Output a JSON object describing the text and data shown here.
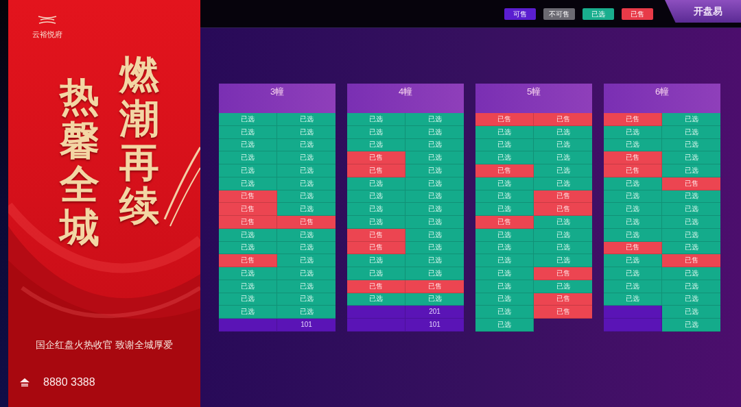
{
  "poster": {
    "brand": "云裕悦府",
    "headline_columns": [
      "燃潮再续",
      "热馨全城"
    ],
    "tagline": "国企红盘火热收官 致谢全城厚爱",
    "phone": "8880 3388"
  },
  "top_bar": {
    "legend": [
      {
        "label": "可售",
        "color": "#5a1ed0"
      },
      {
        "label": "不可售",
        "color": "#6b6a72"
      },
      {
        "label": "已选",
        "color": "#19ae8e"
      },
      {
        "label": "已售",
        "color": "#e83a48"
      }
    ],
    "tab": {
      "label": "开盘易"
    }
  },
  "buildings": [
    {
      "name": "3幢",
      "rows": [
        [
          {
            "kind": "selected",
            "text": "已选"
          },
          {
            "kind": "selected",
            "text": "已选"
          }
        ],
        [
          {
            "kind": "selected",
            "text": "已选"
          },
          {
            "kind": "selected",
            "text": "已选"
          }
        ],
        [
          {
            "kind": "selected",
            "text": "已选"
          },
          {
            "kind": "selected",
            "text": "已选"
          }
        ],
        [
          {
            "kind": "selected",
            "text": "已选"
          },
          {
            "kind": "selected",
            "text": "已选"
          }
        ],
        [
          {
            "kind": "selected",
            "text": "已选"
          },
          {
            "kind": "selected",
            "text": "已选"
          }
        ],
        [
          {
            "kind": "selected",
            "text": "已选"
          },
          {
            "kind": "selected",
            "text": "已选"
          }
        ],
        [
          {
            "kind": "sold",
            "text": "已售"
          },
          {
            "kind": "selected",
            "text": "已选"
          }
        ],
        [
          {
            "kind": "sold",
            "text": "已售"
          },
          {
            "kind": "selected",
            "text": "已选"
          }
        ],
        [
          {
            "kind": "sold",
            "text": "已售"
          },
          {
            "kind": "sold",
            "text": "已售"
          }
        ],
        [
          {
            "kind": "selected",
            "text": "已选"
          },
          {
            "kind": "selected",
            "text": "已选"
          }
        ],
        [
          {
            "kind": "selected",
            "text": "已选"
          },
          {
            "kind": "selected",
            "text": "已选"
          }
        ],
        [
          {
            "kind": "sold",
            "text": "已售"
          },
          {
            "kind": "selected",
            "text": "已选"
          }
        ],
        [
          {
            "kind": "selected",
            "text": "已选"
          },
          {
            "kind": "selected",
            "text": "已选"
          }
        ],
        [
          {
            "kind": "selected",
            "text": "已选"
          },
          {
            "kind": "selected",
            "text": "已选"
          }
        ],
        [
          {
            "kind": "selected",
            "text": "已选"
          },
          {
            "kind": "selected",
            "text": "已选"
          }
        ],
        [
          {
            "kind": "selected",
            "text": "已选"
          },
          {
            "kind": "selected",
            "text": "已选"
          }
        ],
        [
          {
            "kind": "forsale"
          },
          {
            "kind": "forsale",
            "text": "101"
          }
        ]
      ]
    },
    {
      "name": "4幢",
      "rows": [
        [
          {
            "kind": "selected",
            "text": "已选"
          },
          {
            "kind": "selected",
            "text": "已选"
          }
        ],
        [
          {
            "kind": "selected",
            "text": "已选"
          },
          {
            "kind": "selected",
            "text": "已选"
          }
        ],
        [
          {
            "kind": "selected",
            "text": "已选"
          },
          {
            "kind": "selected",
            "text": "已选"
          }
        ],
        [
          {
            "kind": "sold",
            "text": "已售"
          },
          {
            "kind": "selected",
            "text": "已选"
          }
        ],
        [
          {
            "kind": "sold",
            "text": "已售"
          },
          {
            "kind": "selected",
            "text": "已选"
          }
        ],
        [
          {
            "kind": "selected",
            "text": "已选"
          },
          {
            "kind": "selected",
            "text": "已选"
          }
        ],
        [
          {
            "kind": "selected",
            "text": "已选"
          },
          {
            "kind": "selected",
            "text": "已选"
          }
        ],
        [
          {
            "kind": "selected",
            "text": "已选"
          },
          {
            "kind": "selected",
            "text": "已选"
          }
        ],
        [
          {
            "kind": "selected",
            "text": "已选"
          },
          {
            "kind": "selected",
            "text": "已选"
          }
        ],
        [
          {
            "kind": "sold",
            "text": "已售"
          },
          {
            "kind": "selected",
            "text": "已选"
          }
        ],
        [
          {
            "kind": "sold",
            "text": "已售"
          },
          {
            "kind": "selected",
            "text": "已选"
          }
        ],
        [
          {
            "kind": "selected",
            "text": "已选"
          },
          {
            "kind": "selected",
            "text": "已选"
          }
        ],
        [
          {
            "kind": "selected",
            "text": "已选"
          },
          {
            "kind": "selected",
            "text": "已选"
          }
        ],
        [
          {
            "kind": "sold",
            "text": "已售"
          },
          {
            "kind": "sold",
            "text": "已售"
          }
        ],
        [
          {
            "kind": "selected",
            "text": "已选"
          },
          {
            "kind": "selected",
            "text": "已选"
          }
        ],
        [
          {
            "kind": "forsale"
          },
          {
            "kind": "forsale",
            "text": "201"
          }
        ],
        [
          {
            "kind": "forsale"
          },
          {
            "kind": "forsale",
            "text": "101"
          }
        ]
      ]
    },
    {
      "name": "5幢",
      "rows": [
        [
          {
            "kind": "sold",
            "text": "已售"
          },
          {
            "kind": "sold",
            "text": "已售"
          }
        ],
        [
          {
            "kind": "selected",
            "text": "已选"
          },
          {
            "kind": "selected",
            "text": "已选"
          }
        ],
        [
          {
            "kind": "selected",
            "text": "已选"
          },
          {
            "kind": "selected",
            "text": "已选"
          }
        ],
        [
          {
            "kind": "selected",
            "text": "已选"
          },
          {
            "kind": "selected",
            "text": "已选"
          }
        ],
        [
          {
            "kind": "sold",
            "text": "已售"
          },
          {
            "kind": "selected",
            "text": "已选"
          }
        ],
        [
          {
            "kind": "selected",
            "text": "已选"
          },
          {
            "kind": "selected",
            "text": "已选"
          }
        ],
        [
          {
            "kind": "selected",
            "text": "已选"
          },
          {
            "kind": "sold",
            "text": "已售"
          }
        ],
        [
          {
            "kind": "selected",
            "text": "已选"
          },
          {
            "kind": "sold",
            "text": "已售"
          }
        ],
        [
          {
            "kind": "sold",
            "text": "已售"
          },
          {
            "kind": "selected",
            "text": "已选"
          }
        ],
        [
          {
            "kind": "selected",
            "text": "已选"
          },
          {
            "kind": "selected",
            "text": "已选"
          }
        ],
        [
          {
            "kind": "selected",
            "text": "已选"
          },
          {
            "kind": "selected",
            "text": "已选"
          }
        ],
        [
          {
            "kind": "selected",
            "text": "已选"
          },
          {
            "kind": "selected",
            "text": "已选"
          }
        ],
        [
          {
            "kind": "selected",
            "text": "已选"
          },
          {
            "kind": "sold",
            "text": "已售"
          }
        ],
        [
          {
            "kind": "selected",
            "text": "已选"
          },
          {
            "kind": "selected",
            "text": "已选"
          }
        ],
        [
          {
            "kind": "selected",
            "text": "已选"
          },
          {
            "kind": "sold",
            "text": "已售"
          }
        ],
        [
          {
            "kind": "selected",
            "text": "已选"
          },
          {
            "kind": "sold",
            "text": "已售"
          }
        ],
        [
          {
            "kind": "selected",
            "text": "已选"
          }
        ]
      ]
    },
    {
      "name": "6幢",
      "rows": [
        [
          {
            "kind": "sold",
            "text": "已售"
          },
          {
            "kind": "selected",
            "text": "已选"
          }
        ],
        [
          {
            "kind": "selected",
            "text": "已选"
          },
          {
            "kind": "selected",
            "text": "已选"
          }
        ],
        [
          {
            "kind": "selected",
            "text": "已选"
          },
          {
            "kind": "selected",
            "text": "已选"
          }
        ],
        [
          {
            "kind": "sold",
            "text": "已售"
          },
          {
            "kind": "selected",
            "text": "已选"
          }
        ],
        [
          {
            "kind": "sold",
            "text": "已售"
          },
          {
            "kind": "selected",
            "text": "已选"
          }
        ],
        [
          {
            "kind": "selected",
            "text": "已选"
          },
          {
            "kind": "sold",
            "text": "已售"
          }
        ],
        [
          {
            "kind": "selected",
            "text": "已选"
          },
          {
            "kind": "selected",
            "text": "已选"
          }
        ],
        [
          {
            "kind": "selected",
            "text": "已选"
          },
          {
            "kind": "selected",
            "text": "已选"
          }
        ],
        [
          {
            "kind": "selected",
            "text": "已选"
          },
          {
            "kind": "selected",
            "text": "已选"
          }
        ],
        [
          {
            "kind": "selected",
            "text": "已选"
          },
          {
            "kind": "selected",
            "text": "已选"
          }
        ],
        [
          {
            "kind": "sold",
            "text": "已售"
          },
          {
            "kind": "selected",
            "text": "已选"
          }
        ],
        [
          {
            "kind": "selected",
            "text": "已选"
          },
          {
            "kind": "sold",
            "text": "已售"
          }
        ],
        [
          {
            "kind": "selected",
            "text": "已选"
          },
          {
            "kind": "selected",
            "text": "已选"
          }
        ],
        [
          {
            "kind": "selected",
            "text": "已选"
          },
          {
            "kind": "selected",
            "text": "已选"
          }
        ],
        [
          {
            "kind": "selected",
            "text": "已选"
          },
          {
            "kind": "selected",
            "text": "已选"
          }
        ],
        [
          {
            "kind": "forsale"
          },
          {
            "kind": "selected",
            "text": "已选"
          }
        ],
        [
          {
            "kind": "forsale"
          },
          {
            "kind": "selected",
            "text": "已选"
          }
        ]
      ]
    }
  ]
}
